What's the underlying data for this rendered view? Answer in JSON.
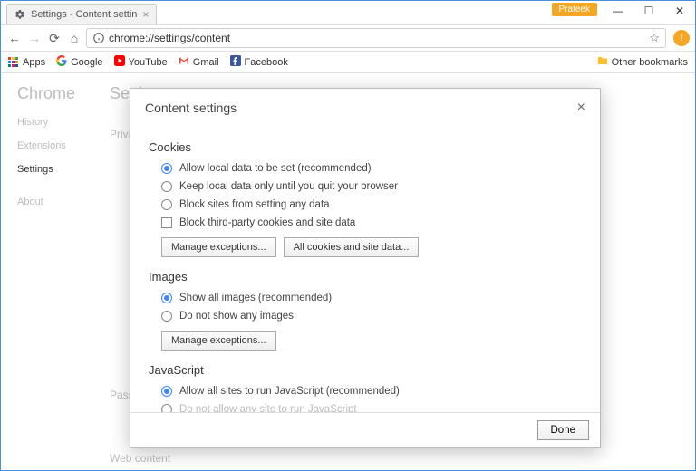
{
  "window": {
    "tab_title": "Settings - Content settin",
    "profile_name": "Prateek"
  },
  "toolbar": {
    "url": "chrome://settings/content"
  },
  "bookmarks": {
    "apps": "Apps",
    "google": "Google",
    "youtube": "YouTube",
    "gmail": "Gmail",
    "facebook": "Facebook",
    "other": "Other bookmarks"
  },
  "page": {
    "chrome": "Chrome",
    "settings": "Settings",
    "side_history": "History",
    "side_extensions": "Extensions",
    "side_settings": "Settings",
    "side_about": "About",
    "privacy": "Priva",
    "passwords": "Pass",
    "web_content": "Web content"
  },
  "modal": {
    "title": "Content settings",
    "done": "Done",
    "sections": {
      "cookies": {
        "title": "Cookies",
        "opt1": "Allow local data to be set (recommended)",
        "opt2": "Keep local data only until you quit your browser",
        "opt3": "Block sites from setting any data",
        "chk1": "Block third-party cookies and site data",
        "btn_manage": "Manage exceptions...",
        "btn_all": "All cookies and site data..."
      },
      "images": {
        "title": "Images",
        "opt1": "Show all images (recommended)",
        "opt2": "Do not show any images",
        "btn_manage": "Manage exceptions..."
      },
      "javascript": {
        "title": "JavaScript",
        "opt1": "Allow all sites to run JavaScript (recommended)",
        "opt2": "Do not allow any site to run JavaScript"
      }
    }
  }
}
